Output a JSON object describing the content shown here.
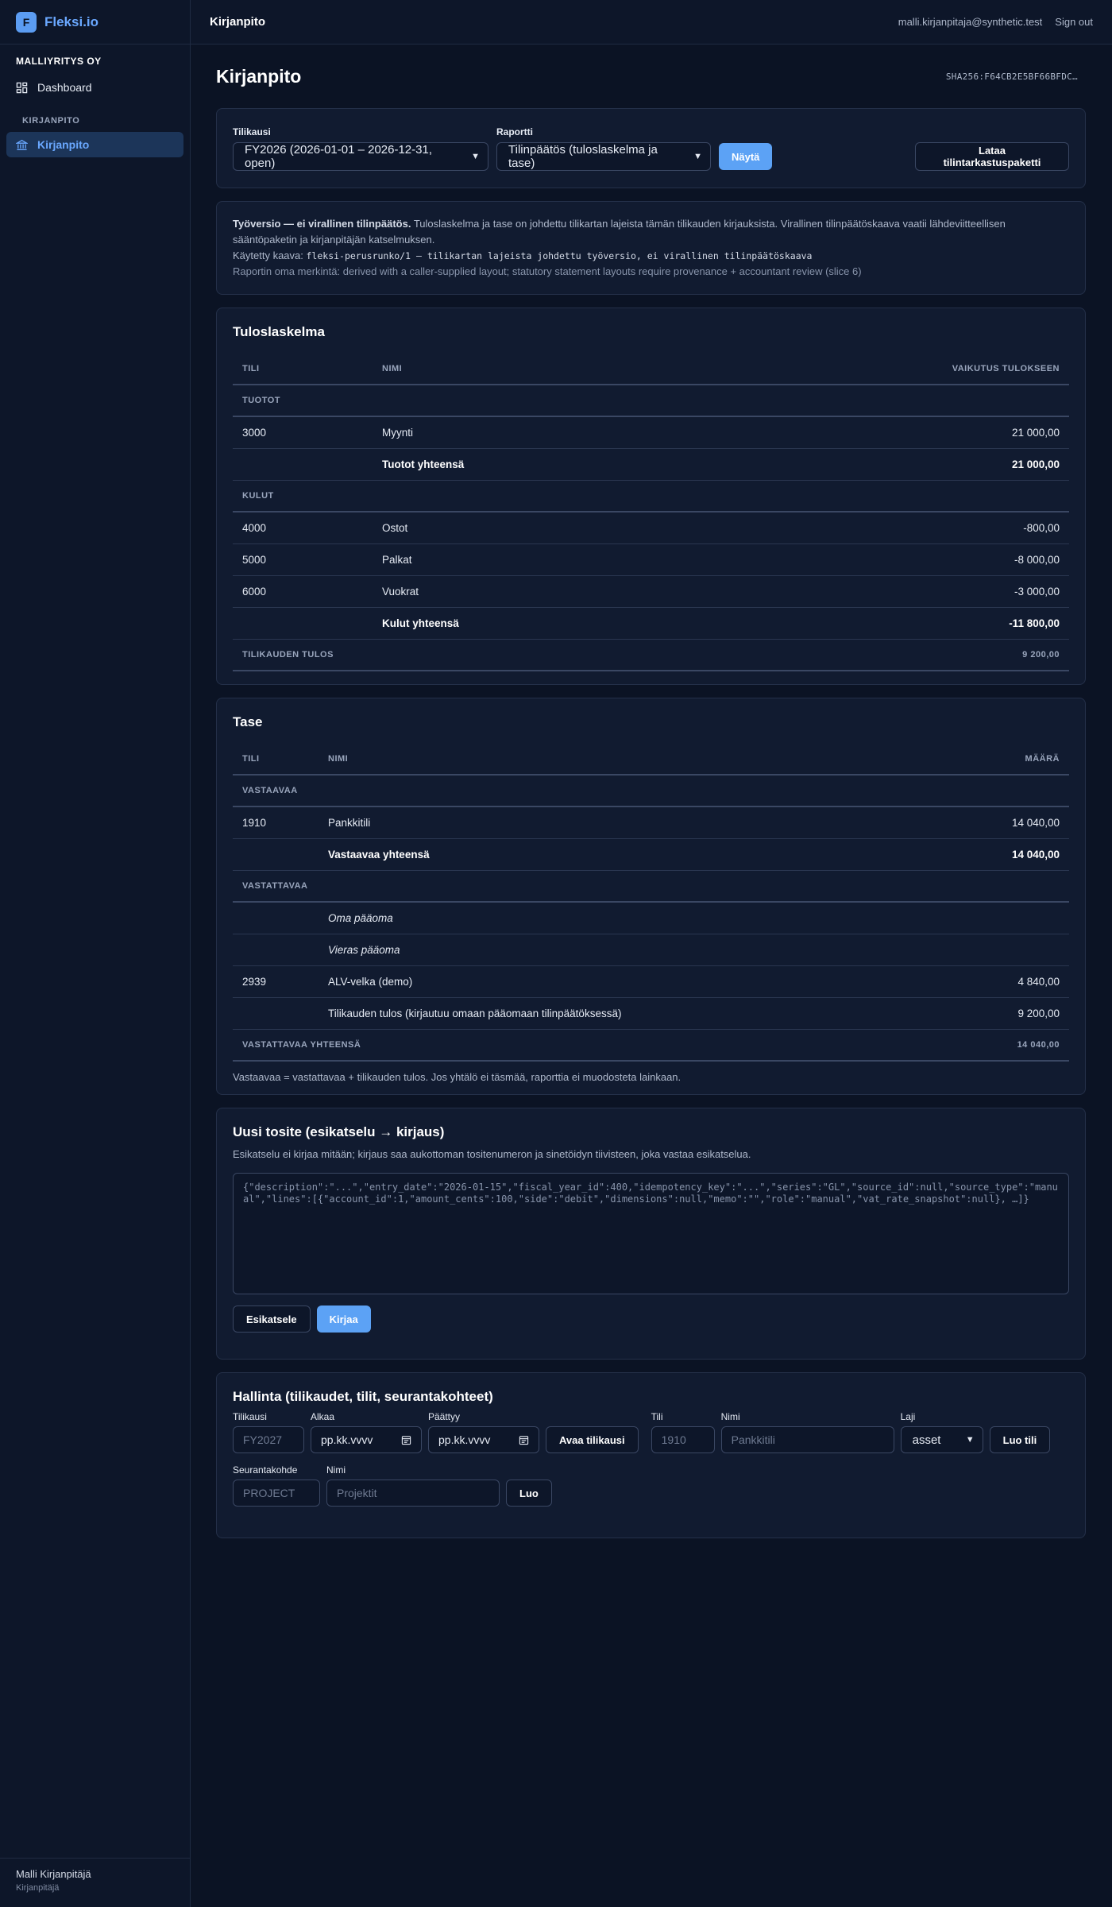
{
  "brand": {
    "logo_letter": "F",
    "name": "Fleksi.io",
    "accent": "#5ca2f5"
  },
  "sidebar": {
    "org": "MALLIYRITYS OY",
    "items": [
      {
        "label": "Dashboard",
        "icon": "dashboard-icon"
      },
      {
        "label": "Kirjanpito",
        "icon": "bank-icon",
        "active": true
      }
    ],
    "section": "KIRJANPITO",
    "footer": {
      "name": "Malli Kirjanpitäjä",
      "role": "Kirjanpitäjä"
    }
  },
  "topbar": {
    "title": "Kirjanpito",
    "email": "malli.kirjanpitaja@synthetic.test",
    "signout": "Sign out"
  },
  "page": {
    "title": "Kirjanpito",
    "hash": "SHA256:F64CB2E5BF66BFDC…"
  },
  "controls": {
    "fiscal_label": "Tilikausi",
    "fiscal_value": "FY2026 (2026-01-01 – 2026-12-31, open)",
    "report_label": "Raportti",
    "report_value": "Tilinpäätös (tuloslaskelma ja tase)",
    "show_button": "Näytä",
    "download_button": "Lataa tilintarkastuspaketti"
  },
  "notice": {
    "bold": "Työversio — ei virallinen tilinpäätös.",
    "text": " Tuloslaskelma ja tase on johdettu tilikartan lajeista tämän tilikauden kirjauksista. Virallinen tilinpäätöskaava vaatii lähdeviitteellisen sääntöpaketin ja kirjanpitäjän katselmuksen.",
    "formula_prefix": "Käytetty kaava: ",
    "formula": "fleksi-perusrunko/1 — tilikartan lajeista johdettu työversio, ei virallinen tilinpäätöskaava",
    "own_note": "Raportin oma merkintä: derived with a caller-supplied layout; statutory statement layouts require provenance + accountant review (slice 6)"
  },
  "income": {
    "title": "Tuloslaskelma",
    "headers": {
      "account": "TILI",
      "name": "NIMI",
      "effect": "VAIKUTUS TULOKSEEN"
    },
    "revenue_section": "TUOTOT",
    "revenue_rows": [
      {
        "account": "3000",
        "name": "Myynti",
        "amount": "21 000,00"
      }
    ],
    "revenue_total": {
      "name": "Tuotot yhteensä",
      "amount": "21 000,00"
    },
    "expense_section": "KULUT",
    "expense_rows": [
      {
        "account": "4000",
        "name": "Ostot",
        "amount": "-800,00"
      },
      {
        "account": "5000",
        "name": "Palkat",
        "amount": "-8 000,00"
      },
      {
        "account": "6000",
        "name": "Vuokrat",
        "amount": "-3 000,00"
      }
    ],
    "expense_total": {
      "name": "Kulut yhteensä",
      "amount": "-11 800,00"
    },
    "result": {
      "label": "TILIKAUDEN TULOS",
      "amount": "9 200,00"
    }
  },
  "balance": {
    "title": "Tase",
    "headers": {
      "account": "TILI",
      "name": "NIMI",
      "amount": "MÄÄRÄ"
    },
    "assets_section": "VASTAAVAA",
    "assets_rows": [
      {
        "account": "1910",
        "name": "Pankkitili",
        "amount": "14 040,00"
      }
    ],
    "assets_total": {
      "name": "Vastaavaa yhteensä",
      "amount": "14 040,00"
    },
    "liab_section": "VASTATTAVAA",
    "equity_label": "Oma pääoma",
    "debt_label": "Vieras pääoma",
    "liab_rows": [
      {
        "account": "2939",
        "name": "ALV-velka (demo)",
        "amount": "4 840,00"
      },
      {
        "account": "",
        "name": "Tilikauden tulos (kirjautuu omaan pääomaan tilinpäätöksessä)",
        "amount": "9 200,00"
      }
    ],
    "liab_total": {
      "label": "VASTATTAVAA YHTEENSÄ",
      "amount": "14 040,00"
    },
    "note": "Vastaavaa = vastattavaa + tilikauden tulos. Jos yhtälö ei täsmää, raporttia ei muodosteta lainkaan."
  },
  "voucher": {
    "title": "Uusi tosite (esikatselu → kirjaus)",
    "subtext": "Esikatselu ei kirjaa mitään; kirjaus saa aukottoman tositenumeron ja sinetöidyn tiivisteen, joka vastaa esikatselua.",
    "placeholder": "{\"description\":\"...\",\"entry_date\":\"2026-01-15\",\"fiscal_year_id\":400,\"idempotency_key\":\"...\",\"series\":\"GL\",\"source_id\":null,\"source_type\":\"manual\",\"lines\":[{\"account_id\":1,\"amount_cents\":100,\"side\":\"debit\",\"dimensions\":null,\"memo\":\"\",\"role\":\"manual\",\"vat_rate_snapshot\":null}, …]}",
    "preview_button": "Esikatsele",
    "post_button": "Kirjaa"
  },
  "admin": {
    "title": "Hallinta (tilikaudet, tilit, seurantakohteet)",
    "fiscal": {
      "label": "Tilikausi",
      "placeholder": "FY2027"
    },
    "start": {
      "label": "Alkaa",
      "value": "pp.kk.vvvv"
    },
    "end": {
      "label": "Päättyy",
      "value": "pp.kk.vvvv"
    },
    "open_button": "Avaa tilikausi",
    "account": {
      "label": "Tili",
      "placeholder": "1910"
    },
    "account_name": {
      "label": "Nimi",
      "placeholder": "Pankkitili"
    },
    "type": {
      "label": "Laji",
      "value": "asset"
    },
    "create_account_button": "Luo tili",
    "dimension": {
      "label": "Seurantakohde",
      "placeholder": "PROJECT"
    },
    "dimension_name": {
      "label": "Nimi",
      "placeholder": "Projektit"
    },
    "create_button": "Luo"
  }
}
